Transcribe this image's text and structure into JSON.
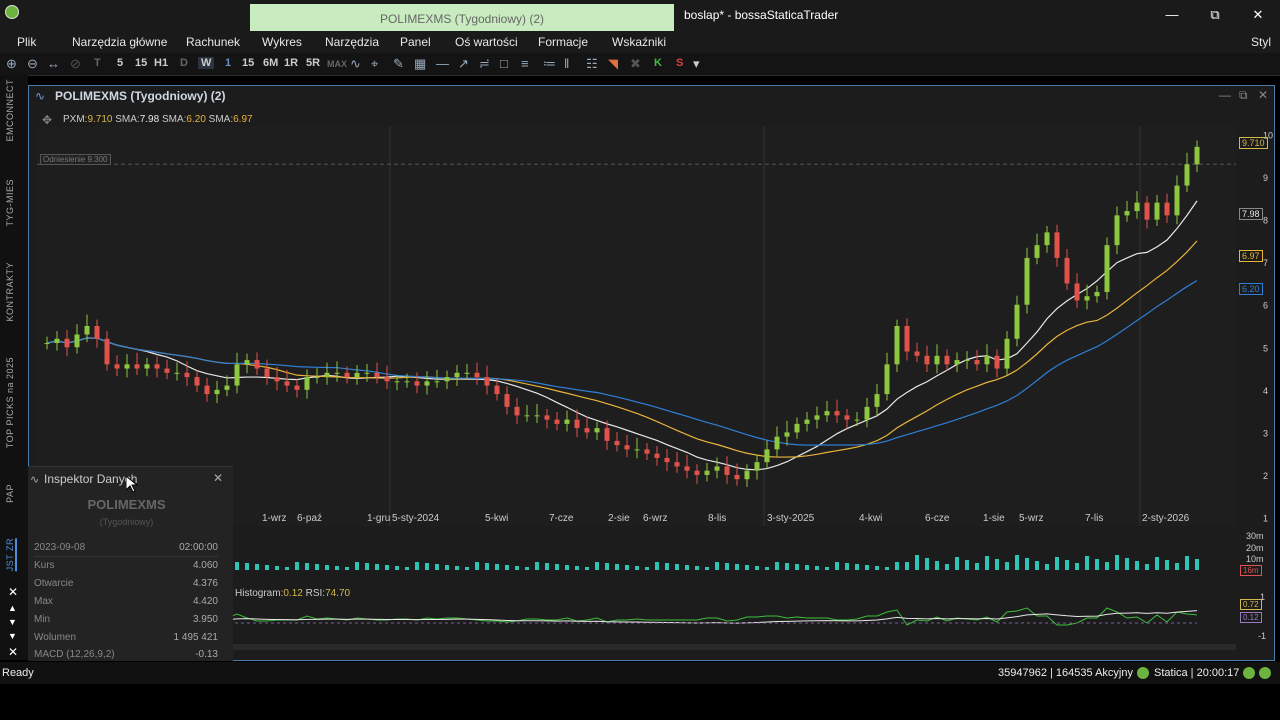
{
  "window": {
    "doc_tab": "POLIMEXMS (Tygodniowy) (2)",
    "title": "boslap* - bossaStaticaTrader",
    "style_label": "Styl"
  },
  "menu": [
    "Plik",
    "Narzędzia główne",
    "Rachunek",
    "Wykres",
    "Narzędzia",
    "Panel",
    "Oś wartości",
    "Formacje",
    "Wskaźniki"
  ],
  "toolbar": {
    "timeframes": [
      "T",
      "5",
      "15",
      "H1",
      "D",
      "W",
      "1",
      "15",
      "6M",
      "1R",
      "5R",
      "MAX"
    ],
    "selected": "W",
    "k_label": "K",
    "s_label": "S"
  },
  "left_tabs": [
    "EMCONNECT",
    "TYG-MIES",
    "KONTRAKTY",
    "TOP PICKS na 2025",
    "PAP",
    "JST ZR"
  ],
  "chart_window": {
    "title": "POLIMEXMS (Tygodniowy) (2)"
  },
  "legend": {
    "pxm_label": "PXM:",
    "pxm_value": "9.710",
    "sma1_label": "SMA:",
    "sma1_value": "7.98",
    "sma2_label": "SMA:",
    "sma2_value": "6.20",
    "sma3_label": "SMA:",
    "sma3_value": "6.97"
  },
  "reference": {
    "label": "Odniesienie",
    "value": "9.300"
  },
  "price_badges": {
    "last": "9.710",
    "sma1": "7.98",
    "sma3": "6.97",
    "sma2": "6.20"
  },
  "volume_axis": [
    "30m",
    "20m",
    "10m"
  ],
  "volume_badge": "16m",
  "indicator": {
    "hist_label": "Histogram:",
    "hist_value": "0.12",
    "rsi_label": "RSI:",
    "rsi_value": "74.70",
    "badge_top": "0.72",
    "badge_bottom": "0.12",
    "axis_top": "1",
    "axis_bottom": "-1"
  },
  "inspector": {
    "title": "Inspektor Danych",
    "symbol": "POLIMEXMS",
    "interval": "(Tygodniowy)",
    "date": "2023-09-08",
    "time": "02:00:00",
    "rows": [
      {
        "label": "Kurs",
        "value": "4.060"
      },
      {
        "label": "Otwarcie",
        "value": "4.376"
      },
      {
        "label": "Max",
        "value": "4.420"
      },
      {
        "label": "Min",
        "value": "3.950"
      },
      {
        "label": "Wolumen",
        "value": "1 495 421"
      },
      {
        "label": "MACD (12,26,9,2)",
        "value": "-0.13"
      }
    ]
  },
  "status": {
    "left": "Ready",
    "conn": "35947962 | 164535 Akcyjny",
    "server": "Statica | 20:00:17"
  },
  "chart_data": {
    "type": "candlestick",
    "title": "POLIMEXMS (Tygodniowy) (2)",
    "y_ticks": [
      1,
      2,
      3,
      4,
      5,
      6,
      7,
      8,
      9,
      10
    ],
    "ylim": [
      0.8,
      10.2
    ],
    "x_tick_labels": [
      "1-wrz",
      "6-paź",
      "1-gru",
      "5-sty-2024",
      "5-kwi",
      "7-cze",
      "2-sie",
      "6-wrz",
      "8-lis",
      "3-sty-2025",
      "4-kwi",
      "6-cze",
      "1-sie",
      "5-wrz",
      "7-lis",
      "2-sty-2026"
    ],
    "close_series": [
      5.1,
      5.2,
      5.0,
      5.3,
      5.5,
      5.2,
      4.6,
      4.5,
      4.6,
      4.5,
      4.6,
      4.5,
      4.4,
      4.4,
      4.3,
      4.1,
      3.9,
      4.0,
      4.1,
      4.6,
      4.7,
      4.5,
      4.3,
      4.2,
      4.1,
      4.0,
      4.3,
      4.3,
      4.4,
      4.4,
      4.3,
      4.4,
      4.4,
      4.3,
      4.2,
      4.2,
      4.2,
      4.1,
      4.2,
      4.2,
      4.3,
      4.4,
      4.4,
      4.3,
      4.1,
      3.9,
      3.6,
      3.4,
      3.4,
      3.4,
      3.3,
      3.2,
      3.3,
      3.1,
      3.0,
      3.1,
      2.8,
      2.7,
      2.6,
      2.6,
      2.5,
      2.4,
      2.3,
      2.2,
      2.1,
      2.0,
      2.1,
      2.2,
      2.0,
      1.9,
      2.1,
      2.3,
      2.6,
      2.9,
      3.0,
      3.2,
      3.3,
      3.4,
      3.5,
      3.4,
      3.3,
      3.3,
      3.6,
      3.9,
      4.6,
      5.5,
      4.9,
      4.8,
      4.6,
      4.8,
      4.6,
      4.7,
      4.7,
      4.6,
      4.8,
      4.5,
      5.2,
      6.0,
      7.1,
      7.4,
      7.7,
      7.1,
      6.5,
      6.1,
      6.2,
      6.3,
      7.4,
      8.1,
      8.2,
      8.4,
      8.0,
      8.4,
      8.1,
      8.8,
      9.3,
      9.71
    ],
    "series": [
      {
        "name": "SMA",
        "value": "7.98",
        "color": "#e8e8e8"
      },
      {
        "name": "SMA",
        "value": "6.97",
        "color": "#e8b43a"
      },
      {
        "name": "SMA",
        "value": "6.20",
        "color": "#2f7fd6"
      }
    ],
    "volume_axis": [
      "30m",
      "20m",
      "10m"
    ],
    "indicator_series": [
      "Histogram",
      "RSI"
    ]
  }
}
